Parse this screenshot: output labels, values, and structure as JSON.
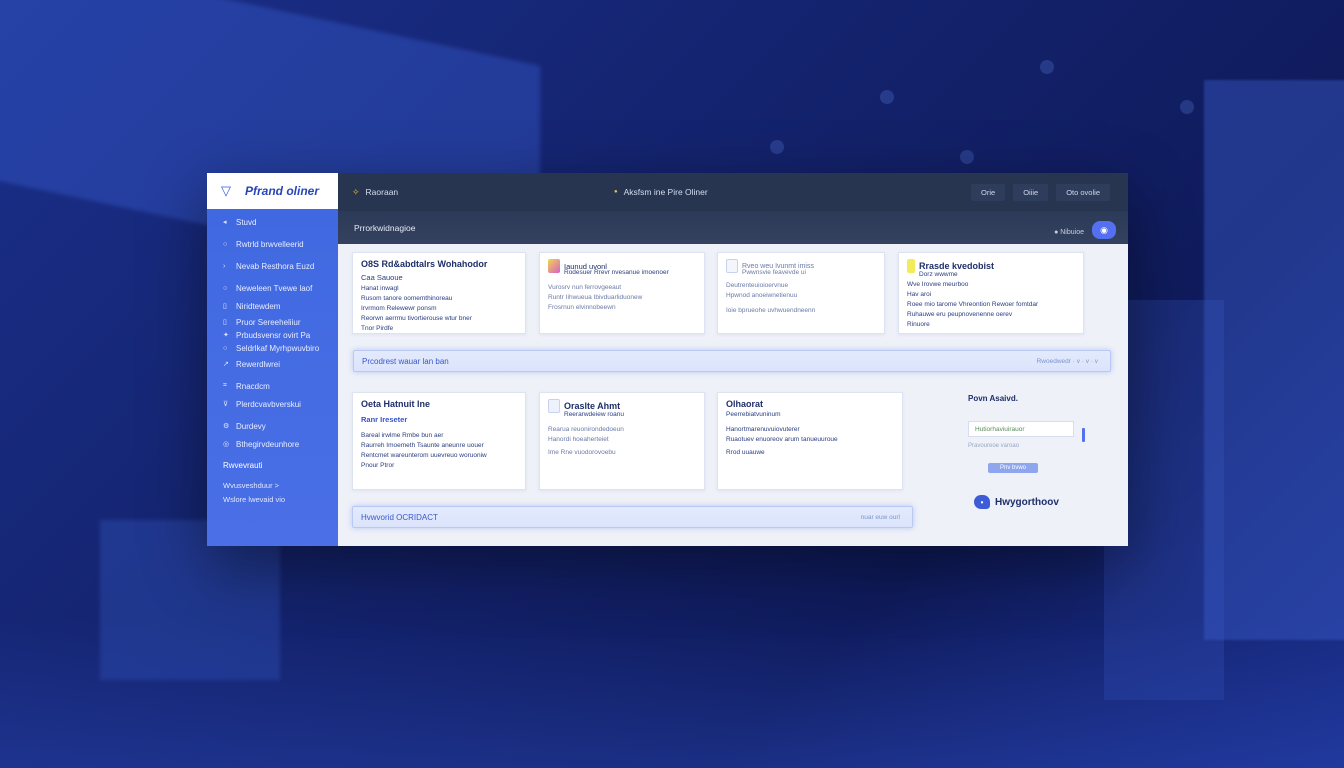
{
  "brand": {
    "name": "Pfrand oliner"
  },
  "sidebar": {
    "items": [
      {
        "label": "Stuvd"
      },
      {
        "label": "Rwtrld brwvelleerid"
      },
      {
        "label": "Nevab Resthora Euzd"
      },
      {
        "label": "Neweleen Tvewe laof"
      },
      {
        "label": "Niridtewdem"
      },
      {
        "label": "Pruor Sereeheliiur"
      },
      {
        "label": "Prbudsvensr ovirt Pa"
      },
      {
        "label": "Seldrlkaf Myrhpwuvbiro"
      },
      {
        "label": "Rewerdlwrei"
      },
      {
        "label": "Rnacdcm"
      },
      {
        "label": "Plerdcvavbverskui"
      },
      {
        "label": "Durdevy"
      },
      {
        "label": "Bthegirvdeunhore"
      }
    ],
    "section_label": "Rwvevrauti",
    "sub_items": [
      {
        "label": "Wvusveshduur >"
      },
      {
        "label": "Wslore lwevaid vio"
      }
    ]
  },
  "topbar": {
    "left_label": "Raoraan",
    "center_label": "Aksfsm ine Pire Oliner",
    "buttons": [
      {
        "label": "Orie"
      },
      {
        "label": "Oiiie"
      },
      {
        "label": "Oto ovolie"
      }
    ]
  },
  "subbar": {
    "title": "Prrorkwidnagioe",
    "status": "Nibuioe"
  },
  "cards_row1": [
    {
      "title": "O8S Rd&abdtalrs Wohahodor",
      "tag": "Caa Sauoue",
      "lines": [
        "Hanat inwagl",
        "Rusom tanore oomemthinoreau",
        "Irvrmom Relewewr ponsm",
        "Reorwn aerrmu tivortierouse wtur bner",
        "Tnor Pirdfe"
      ]
    },
    {
      "title": "Iaunud uvonl",
      "tag": "Rodesuer Rrevr nvesanue imoenoer",
      "lines": [
        "Vurosrv nun ferrovgeeaut",
        "Runtr Iihwueua Ibivduarliduonew",
        "Frosrnun elvinnobeewn"
      ]
    },
    {
      "title": "Rveo weu Ivunmt imiss",
      "tag": "Pwwnsvie feavevde ui",
      "lines": [
        "Deutrenteuioioervnue",
        "Hpwnod anoeiwnetienuu",
        "Ioie bprueohe uvhwuendneenn"
      ]
    },
    {
      "title": "Rrasde kvedobist",
      "tag": "Dorz wwwme",
      "lines": [
        "Wve Irovwe meurboo",
        "Hav aroi",
        "Roee mio tarome Vhreontion Rewoer fomtdar",
        "Ruhauwe eru peupnovenenne oerev",
        "Rinuore"
      ]
    }
  ],
  "bars": [
    {
      "label": "Prcodrest wauar lan ban",
      "right": "Rwoedwedr · v · v · v"
    },
    {
      "label": "Hvwvorid OCRIDACT",
      "right": "nuar euw ourl"
    }
  ],
  "cards_row2": [
    {
      "title": "Oeta Hatnuit lne",
      "tag": "Ranr Ireseter",
      "lines": [
        "Bareal irwlme Rmbe bun aer",
        "Raurreh Imoemeth Tsaunte aneunre uouer",
        "Rentcmet wareunterom uuevreuo woruoniw",
        "Pnour Ptror"
      ]
    },
    {
      "title": "Oraslte Ahmt",
      "tag": "Reerarwdeiew roanu",
      "lines": [
        "Rearua reuonirondedoeun",
        "Hanordi hoeaherteiet",
        "Ime Rne vuodorovoebu"
      ]
    },
    {
      "title": "Olhaorat",
      "tag": "Peerrebiatvuninum",
      "lines": [
        "Hanortmarenuvuiovuterer",
        "Ruaotuev enuoreov arum tanueuuroue",
        "Rrod uuauwe"
      ]
    }
  ],
  "side_panel": {
    "title": "Povn Asaivd.",
    "input_value": "Hutiorhaviuirauor",
    "hint": "Pravoureoe varoao",
    "pill": "Pnv bvwo",
    "logo_text": "Hwygorthoov"
  }
}
